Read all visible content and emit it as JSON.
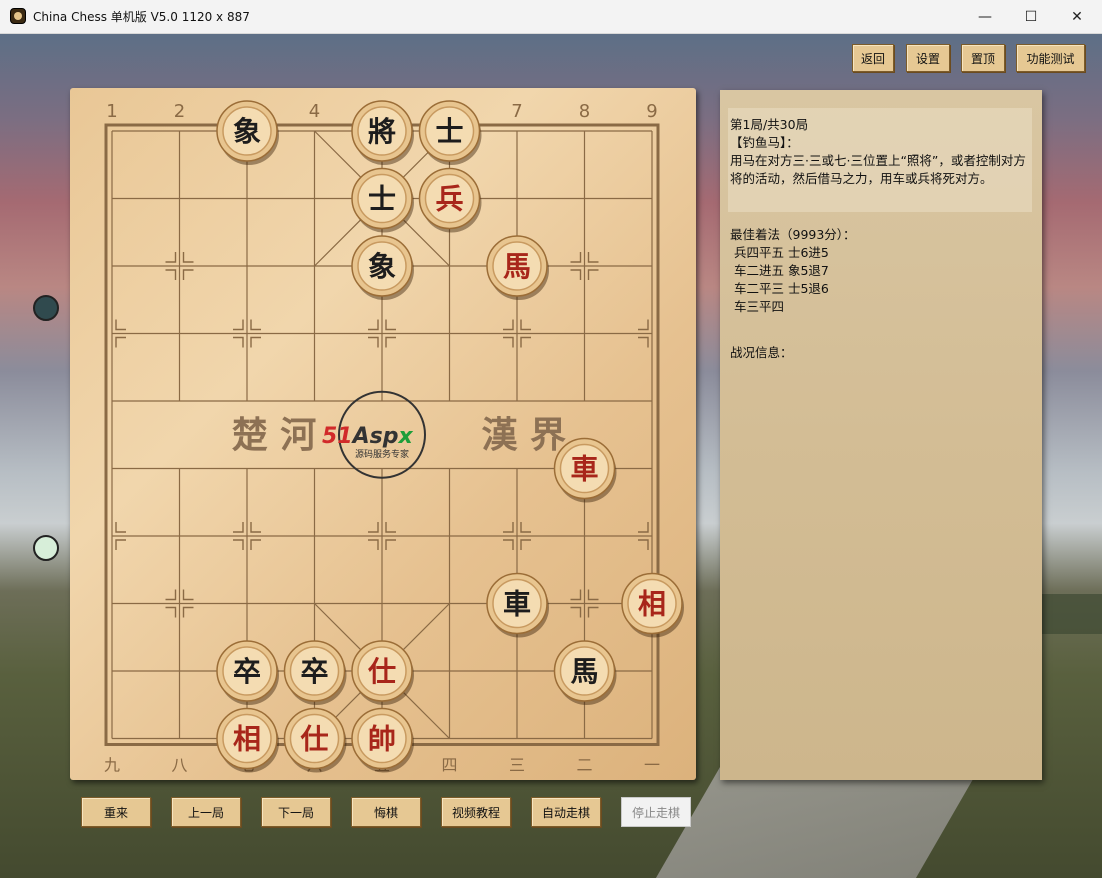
{
  "window": {
    "title": "China Chess 单机版 V5.0  1120 x 887",
    "min": "—",
    "max": "☐",
    "close": "✕"
  },
  "top_buttons": {
    "back": "返回",
    "settings": "设置",
    "top": "置顶",
    "test": "功能测试"
  },
  "board": {
    "top_numbers": [
      "1",
      "2",
      "3",
      "4",
      "5",
      "6",
      "7",
      "8",
      "9"
    ],
    "bottom_numbers": [
      "九",
      "八",
      "七",
      "六",
      "五",
      "四",
      "三",
      "二",
      "一"
    ],
    "river_left": "楚 河",
    "river_right": "漢 界",
    "watermark": {
      "brand_a": "51",
      "brand_b": "Asp",
      "brand_c": "x",
      "sub": "源码服务专家"
    },
    "pieces": [
      {
        "col": 2,
        "row": 0,
        "char": "象",
        "side": "black"
      },
      {
        "col": 4,
        "row": 0,
        "char": "將",
        "side": "black"
      },
      {
        "col": 5,
        "row": 0,
        "char": "士",
        "side": "black"
      },
      {
        "col": 4,
        "row": 1,
        "char": "士",
        "side": "black"
      },
      {
        "col": 5,
        "row": 1,
        "char": "兵",
        "side": "red"
      },
      {
        "col": 4,
        "row": 2,
        "char": "象",
        "side": "black"
      },
      {
        "col": 6,
        "row": 2,
        "char": "馬",
        "side": "red"
      },
      {
        "col": 7,
        "row": 5,
        "char": "車",
        "side": "red"
      },
      {
        "col": 6,
        "row": 7,
        "char": "車",
        "side": "black"
      },
      {
        "col": 8,
        "row": 7,
        "char": "相",
        "side": "red"
      },
      {
        "col": 2,
        "row": 8,
        "char": "卒",
        "side": "black"
      },
      {
        "col": 3,
        "row": 8,
        "char": "卒",
        "side": "black"
      },
      {
        "col": 4,
        "row": 8,
        "char": "仕",
        "side": "red"
      },
      {
        "col": 7,
        "row": 8,
        "char": "馬",
        "side": "black"
      },
      {
        "col": 2,
        "row": 9,
        "char": "相",
        "side": "red"
      },
      {
        "col": 3,
        "row": 9,
        "char": "仕",
        "side": "red"
      },
      {
        "col": 4,
        "row": 9,
        "char": "帥",
        "side": "red"
      }
    ]
  },
  "panel": {
    "game": "第1局/共30局",
    "name": "【钓鱼马】：",
    "desc": "用马在对方三·三或七·三位置上“照将”，或者控制对方将的活动，然后借马之力，用车或兵将死对方。",
    "best_title": "最佳着法（9993分）：",
    "moves": [
      " 兵四平五 士6进5",
      " 车二进五 象5退7",
      " 车二平三 士5退6",
      " 车三平四"
    ],
    "status_label": "战况信息："
  },
  "bottom_buttons": {
    "restart": "重来",
    "prev": "上一局",
    "next": "下一局",
    "undo": "悔棋",
    "video": "视频教程",
    "auto": "自动走棋",
    "stop": "停止走棋"
  },
  "colors": {
    "red_piece": "#a8261a",
    "black_piece": "#1d1d1d",
    "button_bg": "#e6c893",
    "board_line": "#8a6a45"
  }
}
